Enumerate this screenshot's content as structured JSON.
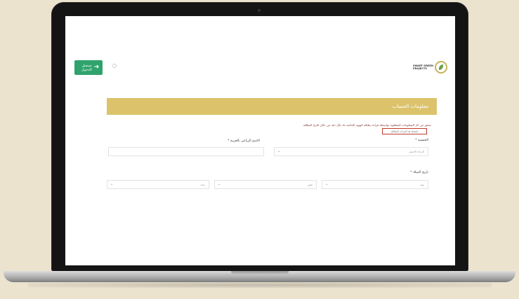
{
  "header": {
    "back_button": {
      "label": "تسجيل الدخول",
      "icon": "arrow-left-icon",
      "color": "#2fa36b"
    },
    "logo": {
      "lines": [
        "SMART GREEN",
        "PROJECTS"
      ]
    }
  },
  "form": {
    "section_title": "معلومات الحساب",
    "header_color": "#dcc36b",
    "instruction": "تحقق من كل المعلومات المطلوبة بواسطة قراءة بطاقة الهوية الخاصة بك بكل دقة من خلال قارئ البطاقة",
    "read_card_link": "اضغط هنا لقراءة البطاقة",
    "fields": {
      "nationality": {
        "label": "الجنسية *",
        "placeholder": "الرجاء الاختيار"
      },
      "name_arabic": {
        "label": "الاسم الرباعي بالعربية *",
        "value": ""
      },
      "birth_date": {
        "label": "تاريخ الميلاد *",
        "day": "يوم",
        "month": "شهر",
        "year": "سنة"
      }
    }
  }
}
